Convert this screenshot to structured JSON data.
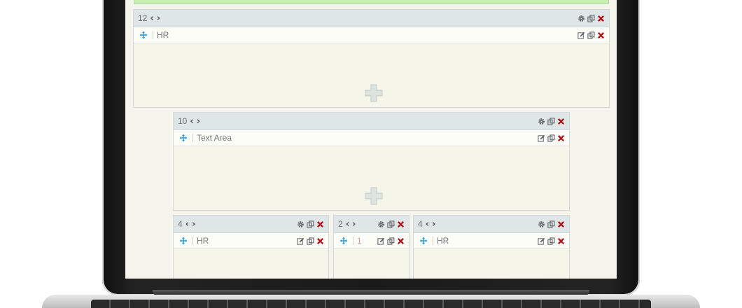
{
  "rows": [
    {
      "width_label": "12",
      "item": {
        "label": "HR"
      }
    },
    {
      "width_label": "10",
      "item": {
        "label": "Text Area"
      }
    },
    {
      "width_label": "4",
      "item": {
        "label": "HR"
      }
    },
    {
      "width_label": "2",
      "item": {
        "label": "1"
      }
    },
    {
      "width_label": "4",
      "item": {
        "label": "HR"
      }
    }
  ],
  "icons": {
    "move": "move-icon",
    "settings": "gear-icon",
    "copy": "copy-icon",
    "delete": "delete-icon",
    "edit": "edit-icon",
    "add": "plus-icon",
    "prev": "chevron-left-icon",
    "next": "chevron-right-icon"
  },
  "colors": {
    "accent_move": "#2a9fd8",
    "delete": "#b0141a",
    "header_bg": "#dfe6e8",
    "row_bg": "#f6f5ea",
    "success_strip": "#c9efb4"
  }
}
